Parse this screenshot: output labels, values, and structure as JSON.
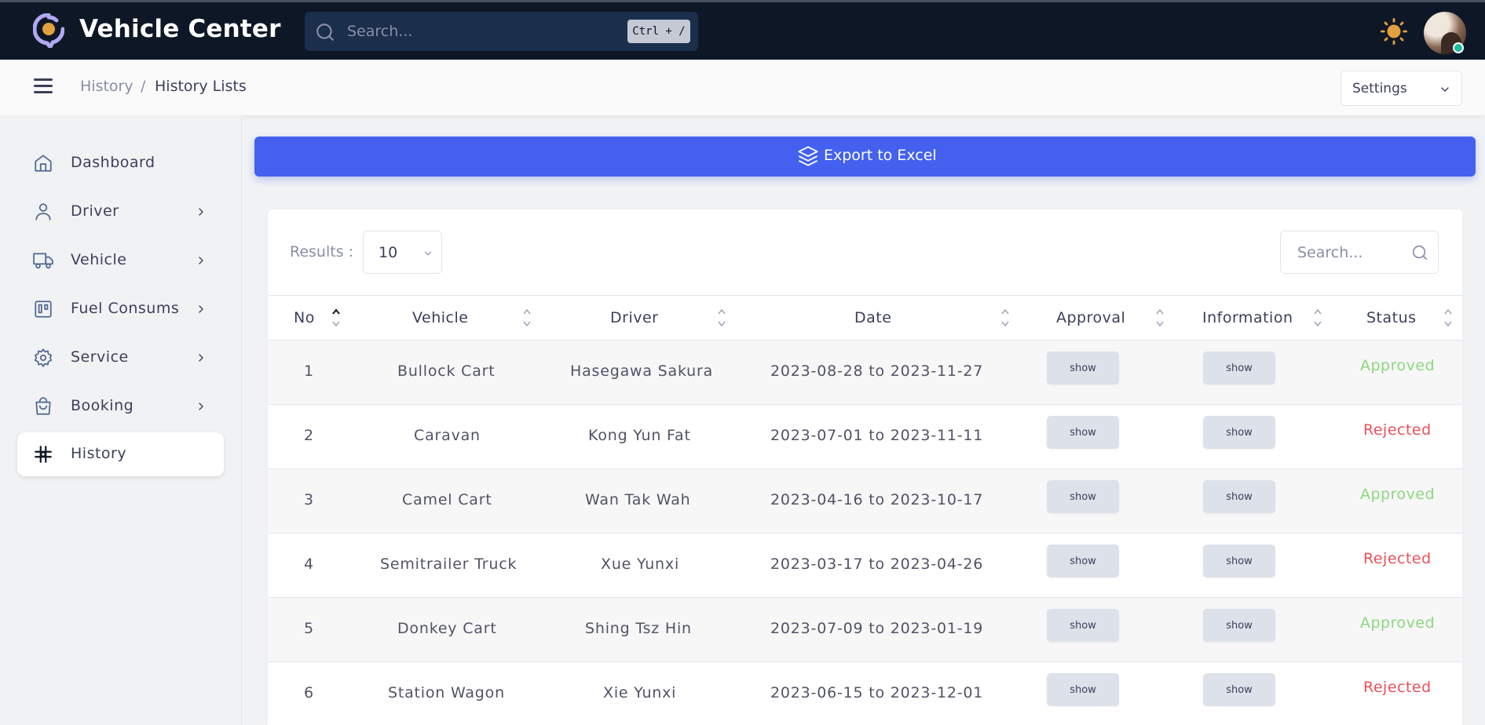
{
  "header": {
    "title": "Vehicle Center",
    "search_placeholder": "Search...",
    "search_shortcut": "Ctrl + /"
  },
  "breadcrumb": {
    "parent": "History",
    "separator": "/",
    "current": "History Lists"
  },
  "settings_label": "Settings",
  "sidebar": {
    "items": [
      {
        "label": "Dashboard",
        "icon": "home-icon"
      },
      {
        "label": "Driver",
        "icon": "user-icon"
      },
      {
        "label": "Vehicle",
        "icon": "truck-icon"
      },
      {
        "label": "Fuel Consums",
        "icon": "kanban-icon"
      },
      {
        "label": "Service",
        "icon": "gear-icon"
      },
      {
        "label": "Booking",
        "icon": "shopping-bag-icon"
      },
      {
        "label": "History",
        "icon": "slack-icon"
      }
    ],
    "active": "History"
  },
  "export_label": "Export to Excel",
  "table": {
    "results_label": "Results :",
    "page_size": "10",
    "search_placeholder": "Search...",
    "columns": [
      "No",
      "Vehicle",
      "Driver",
      "Date",
      "Approval",
      "Information",
      "Status"
    ],
    "button_label": "show",
    "rows": [
      {
        "no": "1",
        "vehicle": "Bullock Cart",
        "driver": "Hasegawa Sakura",
        "date": "2023-08-28 to 2023-11-27",
        "status": "Approved"
      },
      {
        "no": "2",
        "vehicle": "Caravan",
        "driver": "Kong Yun Fat",
        "date": "2023-07-01 to 2023-11-11",
        "status": "Rejected"
      },
      {
        "no": "3",
        "vehicle": "Camel Cart",
        "driver": "Wan Tak Wah",
        "date": "2023-04-16 to 2023-10-17",
        "status": "Approved"
      },
      {
        "no": "4",
        "vehicle": "Semitrailer Truck",
        "driver": "Xue Yunxi",
        "date": "2023-03-17 to 2023-04-26",
        "status": "Rejected"
      },
      {
        "no": "5",
        "vehicle": "Donkey Cart",
        "driver": "Shing Tsz Hin",
        "date": "2023-07-09 to 2023-01-19",
        "status": "Approved"
      },
      {
        "no": "6",
        "vehicle": "Station Wagon",
        "driver": "Xie Yunxi",
        "date": "2023-06-15 to 2023-12-01",
        "status": "Rejected"
      }
    ]
  },
  "colors": {
    "topbar": "#0e1726",
    "primary": "#4361ee",
    "approved": "#8dd77f",
    "rejected": "#e7515a",
    "sun": "#e2a03f"
  }
}
